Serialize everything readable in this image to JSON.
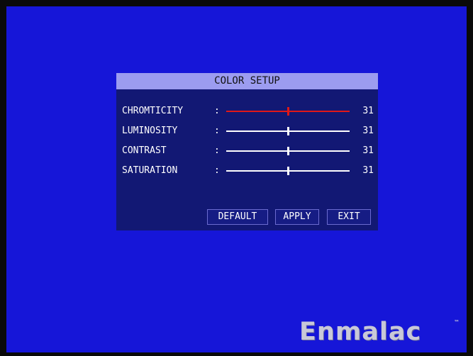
{
  "dialog": {
    "title": "COLOR SETUP",
    "settings": [
      {
        "label": "CHROMTICITY",
        "colon": ":",
        "value": "31",
        "level": 0.5,
        "active": true
      },
      {
        "label": "LUMINOSITY",
        "colon": ":",
        "value": "31",
        "level": 0.5,
        "active": false
      },
      {
        "label": "CONTRAST",
        "colon": ":",
        "value": "31",
        "level": 0.5,
        "active": false
      },
      {
        "label": "SATURATION",
        "colon": ":",
        "value": "31",
        "level": 0.5,
        "active": false
      }
    ],
    "buttons": {
      "default_label": "DEFAULT",
      "apply_label": "APPLY",
      "exit_label": "EXIT"
    }
  },
  "brand": {
    "name": "Enmalac",
    "trademark": "™"
  },
  "colors": {
    "screen_background": "#1616d8",
    "dialog_background": "#121874",
    "title_bar": "#9c9cf0",
    "active_slider": "#e01818",
    "slider": "#ffffff"
  },
  "icons": {
    "slider_thumb": "slider-thumb-icon"
  }
}
